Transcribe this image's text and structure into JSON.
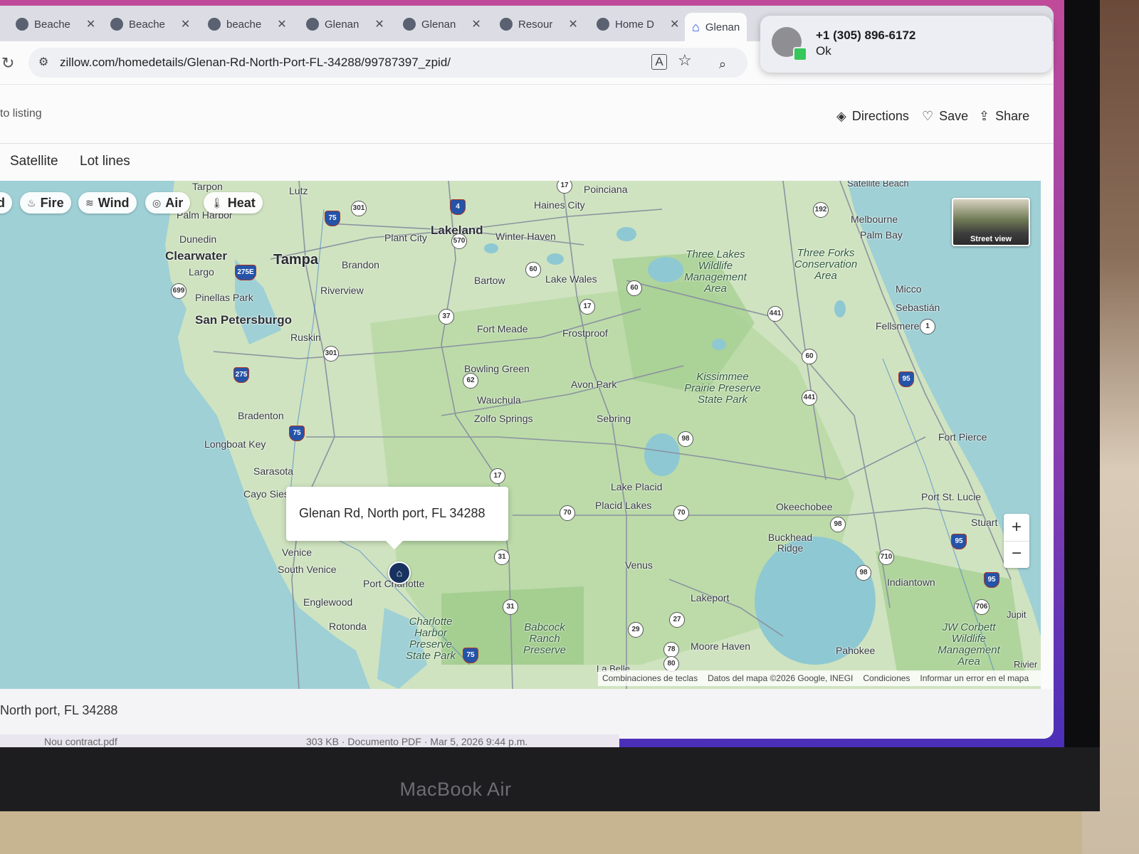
{
  "device": {
    "label": "MacBook Air"
  },
  "tabs": [
    {
      "title": "Beache",
      "icon": "globe-icon",
      "active": false
    },
    {
      "title": "Beache",
      "icon": "globe-icon",
      "active": false
    },
    {
      "title": "beache",
      "icon": "globe-icon",
      "active": false
    },
    {
      "title": "Glenan",
      "icon": "location-icon",
      "active": false
    },
    {
      "title": "Glenan",
      "icon": "location-icon",
      "active": false
    },
    {
      "title": "Resour",
      "icon": "globe-icon",
      "active": false
    },
    {
      "title": "Home D",
      "icon": "chess-icon",
      "active": false
    },
    {
      "title": "Glenan",
      "icon": "zillow-icon",
      "active": true
    }
  ],
  "address_bar": {
    "url": "zillow.com/homedetails/Glenan-Rd-North-Port-FL-34288/99787397_zpid/"
  },
  "listing_header": {
    "back_link": "to listing",
    "directions": "Directions",
    "save": "Save",
    "share": "Share"
  },
  "map_types": {
    "satellite": "Satellite",
    "lot_lines": "Lot lines"
  },
  "overlays": {
    "flood": "d",
    "fire": "Fire",
    "wind": "Wind",
    "air": "Air",
    "heat": "Heat"
  },
  "street_view": {
    "label": "Street view"
  },
  "popup": {
    "address": "Glenan Rd, North port, FL 34288"
  },
  "zoom": {
    "in": "+",
    "out": "−"
  },
  "map_footer": {
    "shortcuts": "Combinaciones de teclas",
    "data": "Datos del mapa ©2026 Google, INEGI",
    "terms": "Condiciones",
    "report": "Informar un error en el mapa"
  },
  "places": {
    "tarpon": "Tarpon",
    "lutz": "Lutz",
    "poinciana": "Poinciana",
    "satellite_beach": "Satellite Beach",
    "haines_city": "Haines City",
    "palm_harbor": "Palm Harbor",
    "dunedin": "Dunedin",
    "clearwater": "Clearwater",
    "tampa": "Tampa",
    "plant_city": "Plant City",
    "lakeland": "Lakeland",
    "winter_haven": "Winter Haven",
    "melbourne": "Melbourne",
    "palm_bay": "Palm Bay",
    "largo": "Largo",
    "brandon": "Brandon",
    "bartow": "Bartow",
    "lake_wales": "Lake Wales",
    "three_lakes": "Three Lakes Wildlife Management Area",
    "three_forks": "Three Forks Conservation Area",
    "pinellas_park": "Pinellas Park",
    "riverview": "Riverview",
    "micco": "Micco",
    "sebastian": "Sebastián",
    "san_petersburgo": "San Petersburgo",
    "ruskin": "Ruskin",
    "fort_meade": "Fort Meade",
    "frostproof": "Frostproof",
    "fellsmere": "Fellsmere",
    "bowling_green": "Bowling Green",
    "kissimmee": "Kissimmee Prairie Preserve State Park",
    "avon_park": "Avon Park",
    "wauchula": "Wauchula",
    "zolfo_springs": "Zolfo Springs",
    "sebring": "Sebring",
    "bradenton": "Bradenton",
    "fort_pierce": "Fort Pierce",
    "longboat_key": "Longboat Key",
    "sarasota": "Sarasota",
    "lake_placid": "Lake Placid",
    "cayo_sies": "Cayo Sies",
    "placid_lakes": "Placid Lakes",
    "port_st_lucie": "Port St. Lucie",
    "okeechobee": "Okeechobee",
    "stuart": "Stuart",
    "buckhead_ridge": "Buckhead Ridge",
    "venice": "Venice",
    "south_venice": "South Venice",
    "venus": "Venus",
    "indiantown": "Indiantown",
    "port_charlotte": "Port Charlotte",
    "englewood": "Englewood",
    "lakeport": "Lakeport",
    "jupiter": "Jupit",
    "charlotte_harbor": "Charlotte Harbor Preserve State Park",
    "babcock": "Babcock Ranch Preserve",
    "rotonda": "Rotonda",
    "moore_haven": "Moore Haven",
    "jw_corbett": "JW Corbett Wildlife Management Area",
    "pahokee": "Pahokee",
    "riviera": "Rivier",
    "la_belle": "La Belle"
  },
  "shields": [
    "17",
    "301",
    "4",
    "75",
    "192",
    "570",
    "60",
    "275E",
    "699",
    "17",
    "441",
    "37",
    "60",
    "301",
    "62",
    "275",
    "95",
    "441",
    "75",
    "98",
    "17",
    "70",
    "70",
    "98",
    "95",
    "710",
    "31",
    "98",
    "95",
    "706",
    "31",
    "27",
    "29",
    "78",
    "80",
    "75",
    "1",
    "60"
  ],
  "listing_address": "North port, FL 34288",
  "notification": {
    "phone": "+1 (305) 896-6172",
    "message": "Ok"
  },
  "download_shelf": {
    "left": "Nou contract.pdf",
    "right": "303 KB · Documento PDF · Mar 5, 2026 9:44 p.m."
  }
}
